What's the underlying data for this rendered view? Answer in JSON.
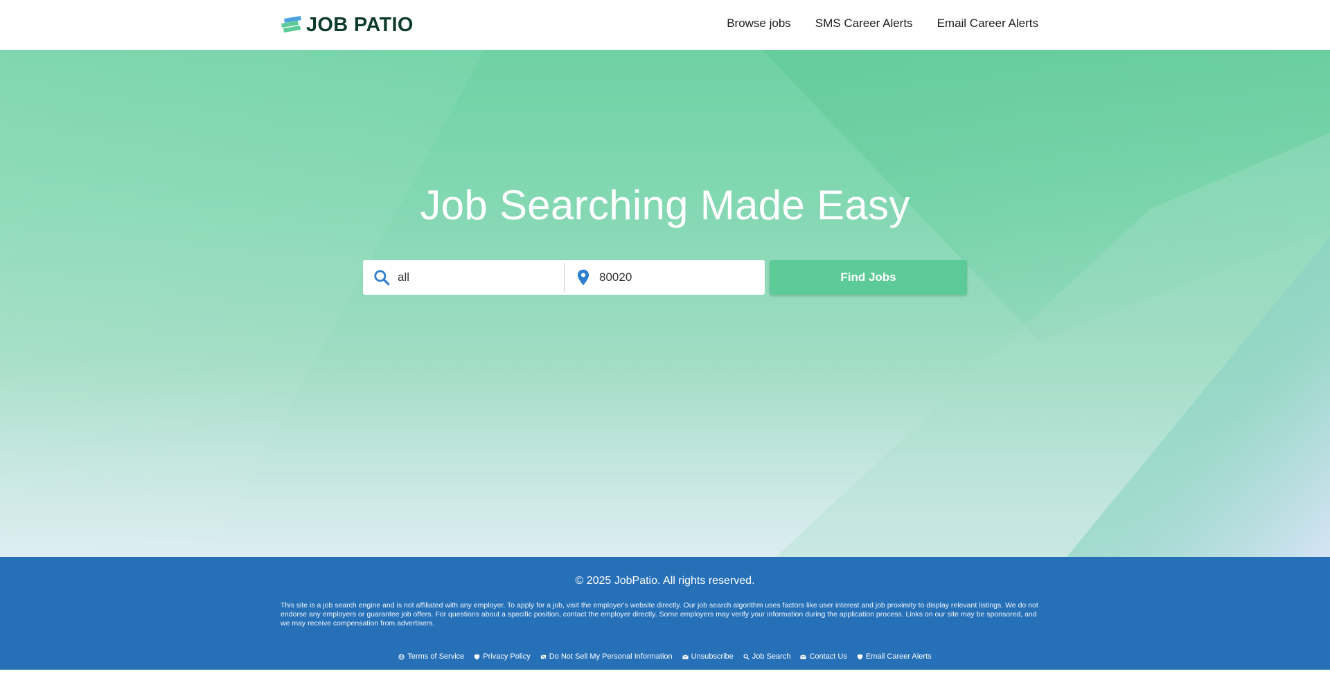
{
  "brand": {
    "name": "JOB PATIO",
    "logo_colors": [
      "#4aa3df",
      "#5ccb98"
    ],
    "text_color": "#0d3b2e"
  },
  "nav": [
    {
      "label": "Browse jobs"
    },
    {
      "label": "SMS Career Alerts"
    },
    {
      "label": "Email Career Alerts"
    }
  ],
  "hero": {
    "title": "Job Searching Made Easy",
    "keyword": {
      "icon": "search-icon",
      "value": "all"
    },
    "location": {
      "icon": "location-pin-icon",
      "value": "80020"
    },
    "submit_label": "Find Jobs"
  },
  "footer": {
    "copyright": "© 2025 JobPatio. All rights reserved.",
    "disclaimer": "This site is a job search engine and is not affiliated with any employer. To apply for a job, visit the employer's website directly. Our job search algorithm uses factors like user interest and job proximity to display relevant listings. We do not endorse any employers or guarantee job offers. For questions about a specific position, contact the employer directly. Some employers may verify your information during the application process. Links on our site may be sponsored, and we may receive compensation from advertisers.",
    "links": [
      {
        "icon": "globe-icon",
        "label": "Terms of Service"
      },
      {
        "icon": "shield-icon",
        "label": "Privacy Policy"
      },
      {
        "icon": "block-icon",
        "label": "Do Not Sell My Personal Information"
      },
      {
        "icon": "mail-icon",
        "label": "Unsubscribe"
      },
      {
        "icon": "search-icon",
        "label": "Job Search"
      },
      {
        "icon": "mail-icon",
        "label": "Contact Us"
      },
      {
        "icon": "shield-icon",
        "label": "Email Career Alerts"
      }
    ]
  },
  "colors": {
    "accent": "#5ccb98",
    "footer_bg": "#2670b8",
    "icon_blue": "#2e7fd1"
  }
}
